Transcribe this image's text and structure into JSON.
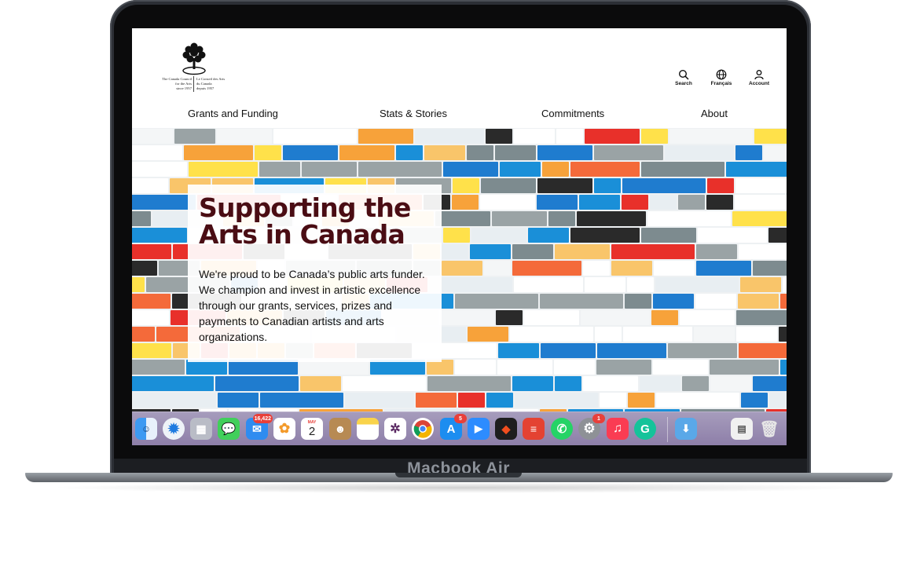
{
  "device": {
    "model_label": "Macbook Air"
  },
  "site": {
    "logo": {
      "english_text": "The Canada Council\nfor the Arts\nsince 1957",
      "french_text": "Le Conseil des Arts\ndu Canada\ndepuis 1957"
    },
    "utilities": {
      "search_label": "Search",
      "language_label": "Français",
      "account_label": "Account"
    },
    "nav": {
      "items": [
        "Grants and Funding",
        "Stats & Stories",
        "Commitments",
        "About"
      ]
    },
    "hero": {
      "title": "Supporting the Arts in Canada",
      "body": "We're proud to be Canada’s public arts funder. We champion and invest in artistic excellence through our grants, services, prizes and payments to Canadian artists and arts organizations."
    }
  },
  "dock": {
    "mail_badge": "16,422",
    "calendar_month": "MAY",
    "calendar_day": "2",
    "appstore_badge": "5",
    "settings_badge": "1",
    "apps": [
      "finder",
      "safari",
      "launchpad",
      "messages",
      "mail",
      "photos",
      "calendar",
      "contacts",
      "notes",
      "slack",
      "chrome",
      "app-store",
      "zoom",
      "figma",
      "todoist",
      "whatsapp",
      "system-settings",
      "music",
      "grammarly",
      "downloads",
      "preview",
      "trash"
    ]
  },
  "colors": {
    "title": "#4a0d14",
    "brick_red": "#e8302a",
    "brick_blue": "#1f7ccf",
    "brick_orange": "#f7a23a",
    "brick_gray": "#9aa3a5"
  }
}
